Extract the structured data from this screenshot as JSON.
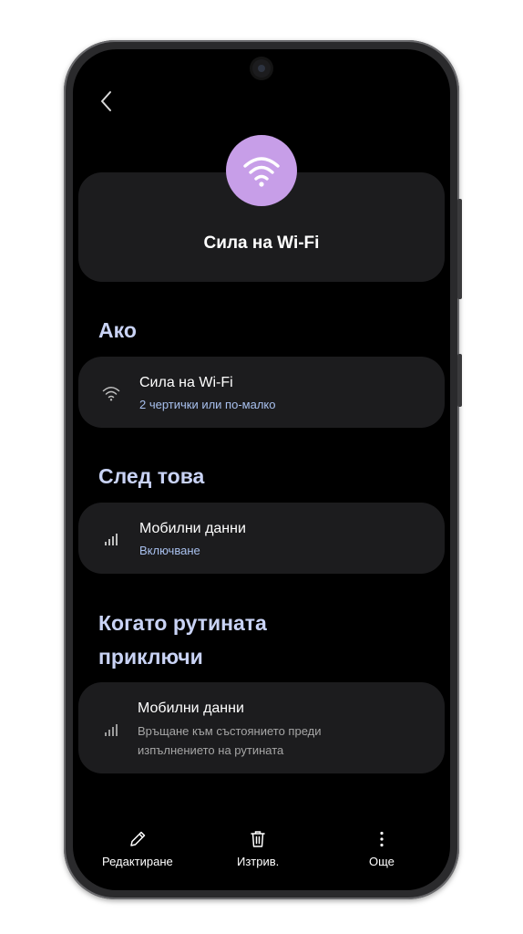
{
  "header": {
    "back_icon": "chevron-left-icon",
    "title": "Сила на Wi-Fi",
    "hero_icon": "wifi-icon",
    "hero_color": "#c79ee8"
  },
  "sections": {
    "if": {
      "heading": "Ако",
      "item": {
        "icon": "wifi-icon",
        "title": "Сила на Wi-Fi",
        "subtitle": "2 чертички или по-малко"
      }
    },
    "then": {
      "heading": "След това",
      "item": {
        "icon": "signal-bars-icon",
        "title": "Мобилни данни",
        "subtitle": "Включване"
      }
    },
    "end": {
      "heading_line1": "Когато рутината",
      "heading_line2": "приключи",
      "item": {
        "icon": "signal-bars-icon",
        "title": "Мобилни данни",
        "subtitle_line1": "Връщане към състоянието преди",
        "subtitle_line2": "изпълнението на рутината"
      }
    }
  },
  "toolbar": {
    "edit_label": "Редактиране",
    "delete_label": "Изтрив.",
    "more_label": "Още"
  },
  "colors": {
    "accent_text": "#c9d3f5",
    "subtitle_text": "#a8c0ee",
    "card_bg": "#1c1c1e"
  }
}
